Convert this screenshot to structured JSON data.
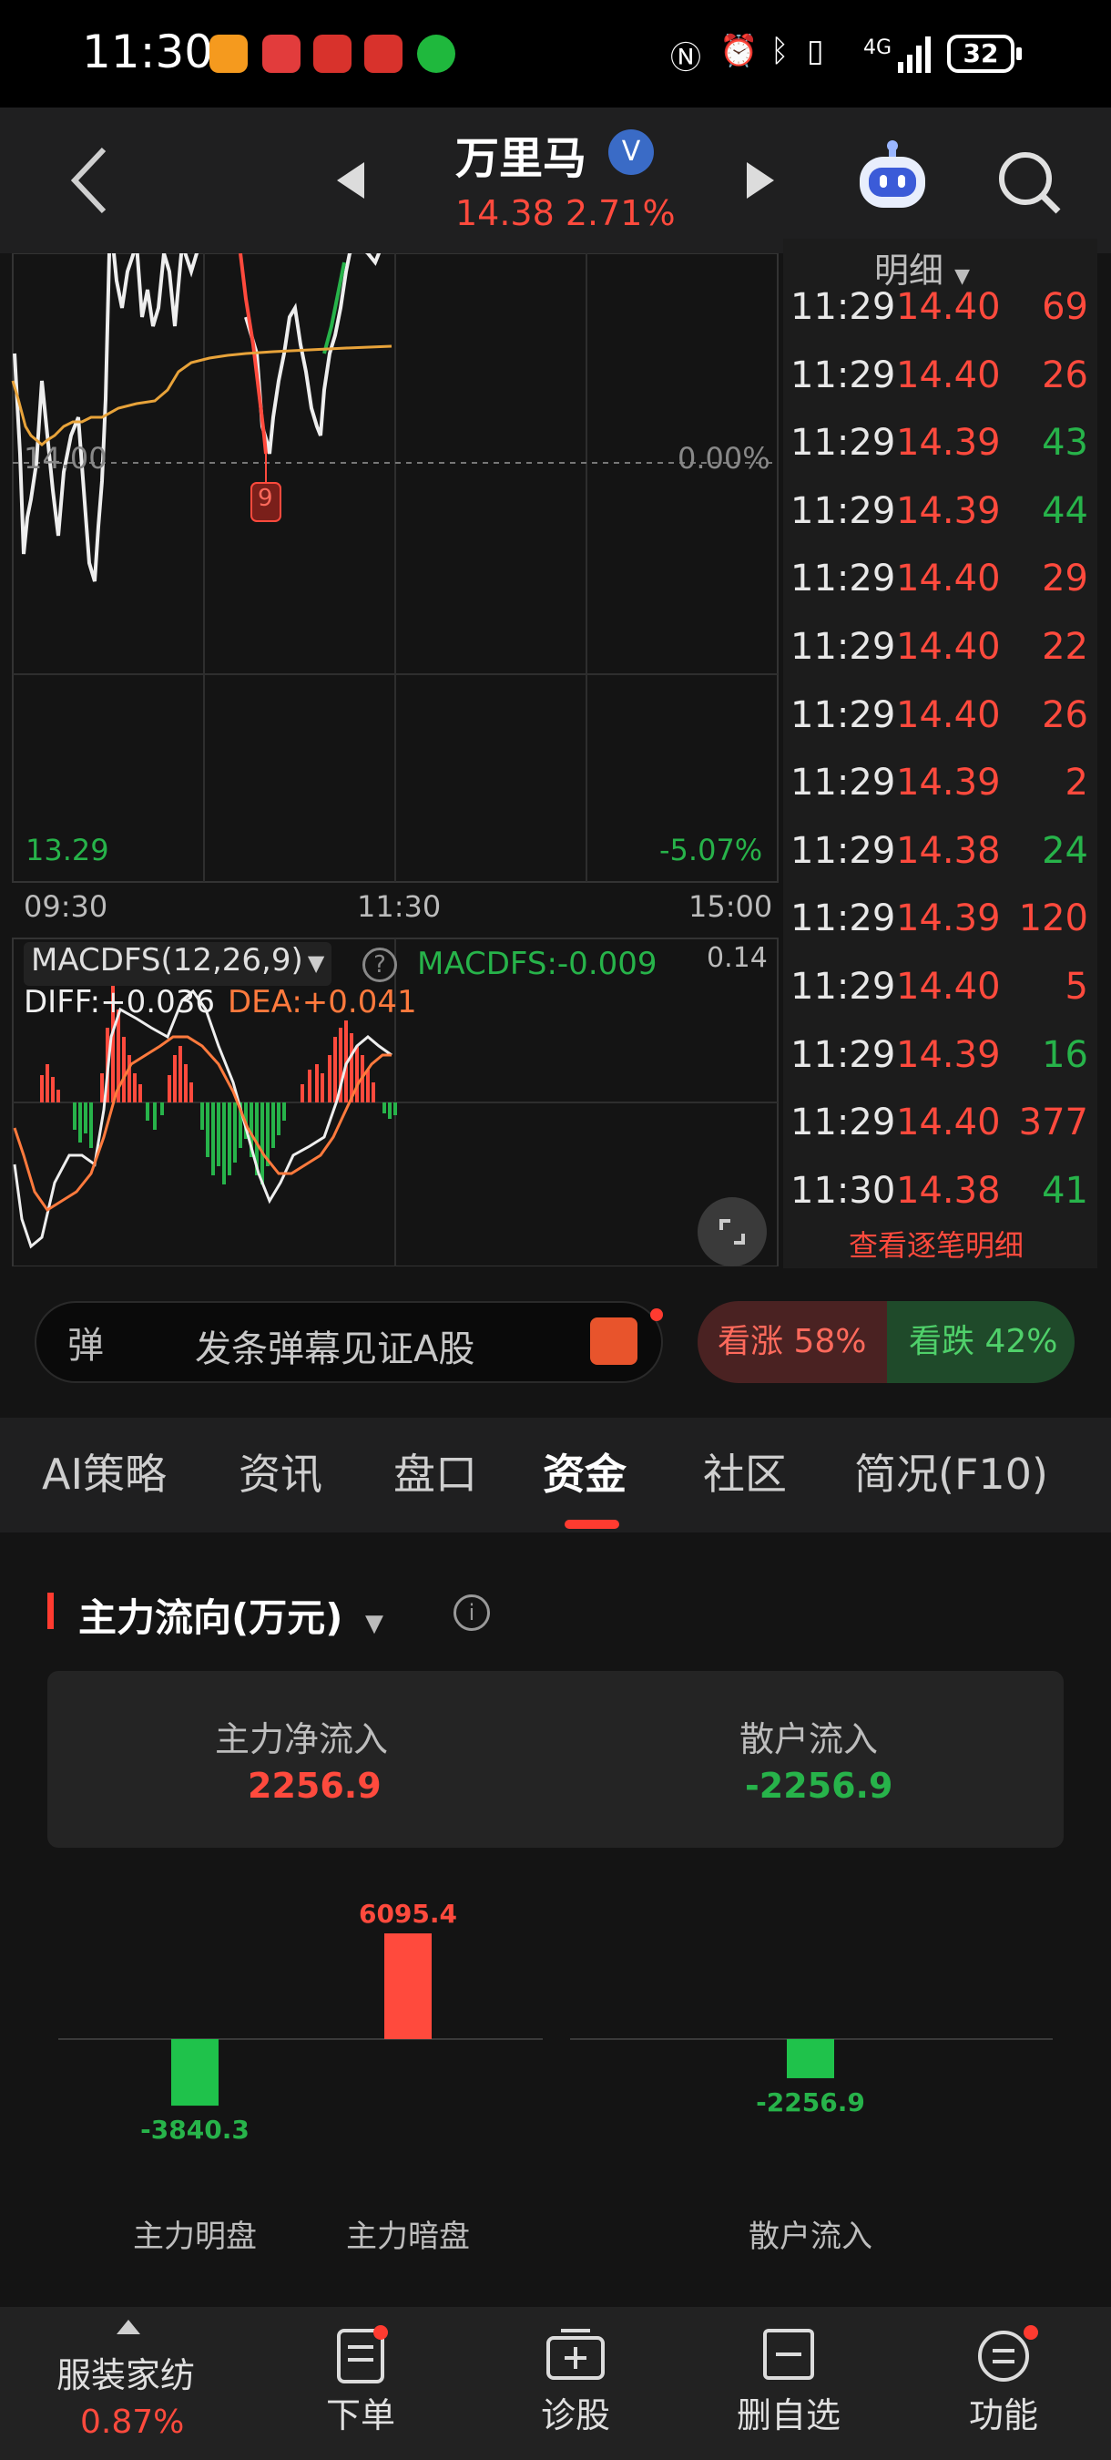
{
  "status_bar": {
    "time": "11:30",
    "battery": "32",
    "network": "4G"
  },
  "header": {
    "title": "万里马",
    "verified_mark": "V",
    "price_line": "14.38  2.71%"
  },
  "chart": {
    "price_zero_label": "14.00",
    "pct_zero_label": "0.00%",
    "low_price": "13.29",
    "low_pct": "-5.07%",
    "marker_badge": "9",
    "time_axis": [
      "09:30",
      "11:30",
      "15:00"
    ],
    "indicator_name": "MACDFS(12,26,9)",
    "indicator_value": "MACDFS:-0.009",
    "indicator_max": "0.14",
    "diff": "DIFF:+0.036",
    "dea": "DEA:+0.041"
  },
  "ticks": {
    "header": "明细",
    "rows": [
      {
        "time": "11:29",
        "price": "14.40",
        "vol": "69",
        "dir": "up"
      },
      {
        "time": "11:29",
        "price": "14.40",
        "vol": "26",
        "dir": "up"
      },
      {
        "time": "11:29",
        "price": "14.39",
        "vol": "43",
        "dir": "down"
      },
      {
        "time": "11:29",
        "price": "14.39",
        "vol": "44",
        "dir": "down"
      },
      {
        "time": "11:29",
        "price": "14.40",
        "vol": "29",
        "dir": "up"
      },
      {
        "time": "11:29",
        "price": "14.40",
        "vol": "22",
        "dir": "up"
      },
      {
        "time": "11:29",
        "price": "14.40",
        "vol": "26",
        "dir": "up"
      },
      {
        "time": "11:29",
        "price": "14.39",
        "vol": "2",
        "dir": "up"
      },
      {
        "time": "11:29",
        "price": "14.38",
        "vol": "24",
        "dir": "down"
      },
      {
        "time": "11:29",
        "price": "14.39",
        "vol": "120",
        "dir": "up"
      },
      {
        "time": "11:29",
        "price": "14.40",
        "vol": "5",
        "dir": "up"
      },
      {
        "time": "11:29",
        "price": "14.39",
        "vol": "16",
        "dir": "down"
      },
      {
        "time": "11:29",
        "price": "14.40",
        "vol": "377",
        "dir": "up"
      },
      {
        "time": "11:30",
        "price": "14.38",
        "vol": "41",
        "dir": "down"
      }
    ],
    "more_link": "查看逐笔明细"
  },
  "danmaku": {
    "badge": "弹",
    "placeholder": "发条弹幕见证A股",
    "bull_label": "看涨 58%",
    "bear_label": "看跌 42%"
  },
  "tabs": [
    {
      "label": "AI策略"
    },
    {
      "label": "资讯"
    },
    {
      "label": "盘口"
    },
    {
      "label": "资金",
      "active": true
    },
    {
      "label": "社区"
    },
    {
      "label": "简况(F10)"
    }
  ],
  "fund_flow": {
    "title": "主力流向(万元)",
    "main_net_label": "主力净流入",
    "main_net_value": "2256.9",
    "retail_label": "散户流入",
    "retail_value": "-2256.9",
    "bars": [
      {
        "label": "主力明盘",
        "value": -3840.3,
        "text": "-3840.3"
      },
      {
        "label": "主力暗盘",
        "value": 6095.4,
        "text": "6095.4"
      },
      {
        "label": "散户流入",
        "value": -2256.9,
        "text": "-2256.9"
      }
    ]
  },
  "bottom_nav": {
    "sector_name": "服装家纺",
    "sector_change": "0.87%",
    "items": [
      {
        "label": "下单"
      },
      {
        "label": "诊股"
      },
      {
        "label": "删自选"
      },
      {
        "label": "功能"
      }
    ]
  },
  "colors": {
    "up": "#ff4a3d",
    "down": "#27b34a",
    "avg_line": "#e8a33a"
  }
}
